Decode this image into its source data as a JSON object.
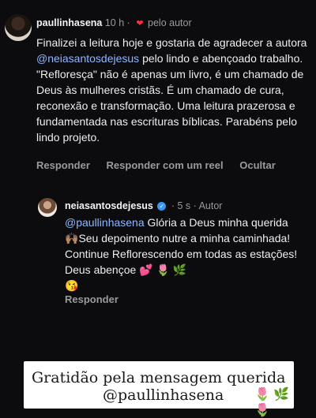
{
  "comment": {
    "username": "paullinhasena",
    "time": "10 h",
    "separator": "·",
    "liked_by": "pelo autor",
    "text_before_mention": "Finalizei a leitura hoje e gostaria de agradecer a autora ",
    "mention": "@neiasantosdejesus",
    "text_after_mention": " pelo lindo e abençoado trabalho. \"Refloresça\" não é apenas um livro, é um chamado de Deus às mulheres cristãs. É um chamado de cura, reconexão e transformação. Uma leitura prazerosa e fundamentada nas escrituras bíblicas. Parabéns pelo lindo projeto.",
    "actions": [
      "Responder",
      "Responder com um reel",
      "Ocultar"
    ]
  },
  "reply": {
    "username": "neiasantosdejesus",
    "verified_mark": "✓",
    "time": "· 5 s ·",
    "role": "Autor",
    "mention": "@paullinhasena",
    "text_1": " Glória a Deus minha querida",
    "emoji_hands": "🙌🏽",
    "text_2": "Seu depoimento nutre a minha caminhada! Continue Reflorescendo em todas as estações! Deus abençoe ",
    "emoji_end": "💕 🌷 🌿",
    "emoji_kiss": "😘",
    "action": "Responder"
  },
  "card": {
    "line1": "Gratidão pela mensagem querida",
    "line2": "@paullinhasena",
    "emojis": "🌷 🌿 🌷"
  }
}
